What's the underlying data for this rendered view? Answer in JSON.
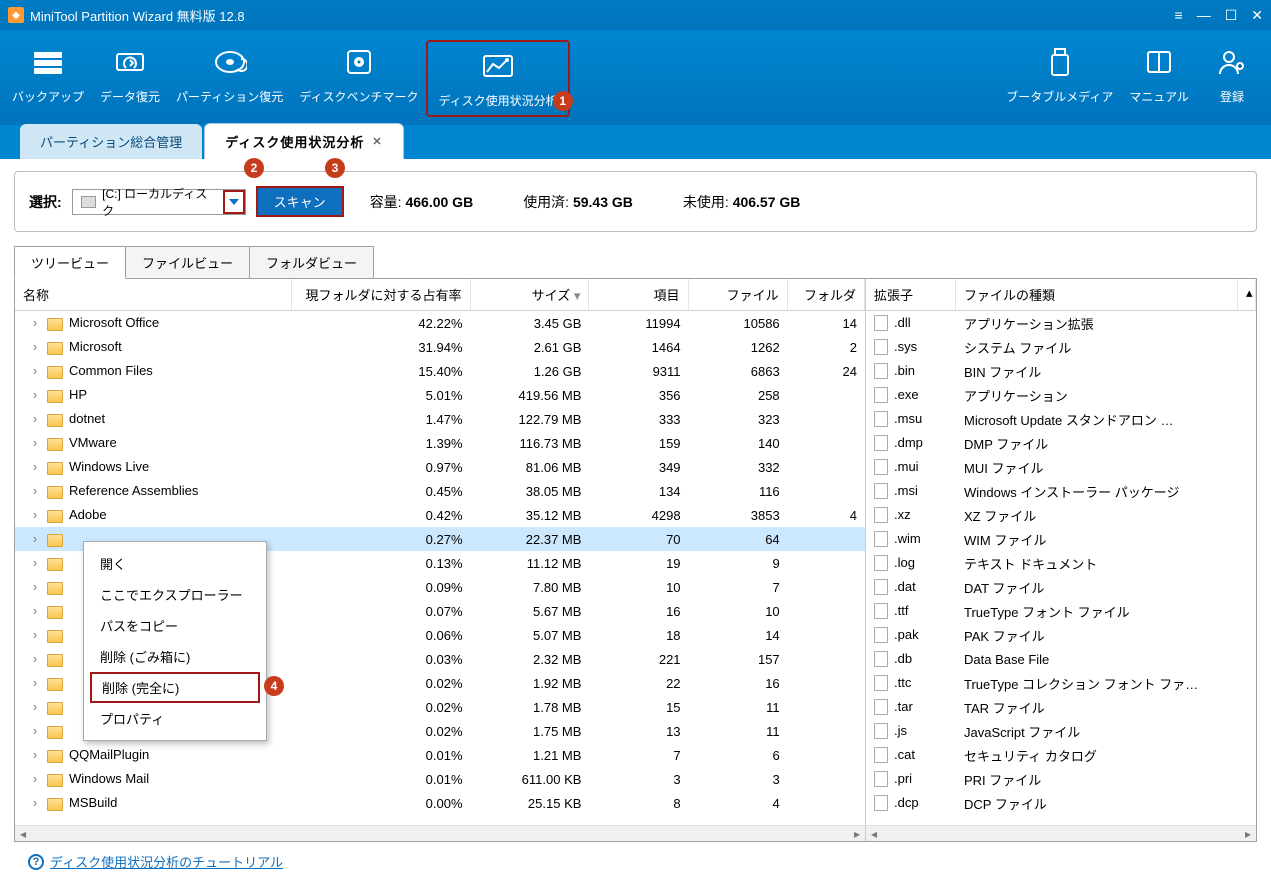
{
  "title": "MiniTool Partition Wizard 無料版 12.8",
  "toolbar": [
    {
      "label": "バックアップ",
      "icon": "backup-icon"
    },
    {
      "label": "データ復元",
      "icon": "data-recovery-icon"
    },
    {
      "label": "パーティション復元",
      "icon": "partition-recovery-icon"
    },
    {
      "label": "ディスクベンチマーク",
      "icon": "benchmark-icon"
    },
    {
      "label": "ディスク使用状況分析",
      "icon": "space-analyzer-icon"
    }
  ],
  "toolbar_right": [
    {
      "label": "ブータブルメディア",
      "icon": "usb-icon"
    },
    {
      "label": "マニュアル",
      "icon": "manual-icon"
    },
    {
      "label": "登録",
      "icon": "register-icon"
    }
  ],
  "app_tabs": {
    "inactive": "パーティション総合管理",
    "active": "ディスク使用状況分析"
  },
  "scan": {
    "select_label": "選択:",
    "selected_disk": "[C:] ローカルディスク",
    "scan_btn": "スキャン",
    "capacity_label": "容量:",
    "capacity_value": "466.00 GB",
    "used_label": "使用済:",
    "used_value": "59.43 GB",
    "free_label": "未使用:",
    "free_value": "406.57 GB"
  },
  "view_tabs": [
    "ツリービュー",
    "ファイルビュー",
    "フォルダビュー"
  ],
  "tree_headers": {
    "name": "名称",
    "pct": "現フォルダに対する占有率",
    "size": "サイズ",
    "items": "項目",
    "files": "ファイル",
    "folders": "フォルダ"
  },
  "tree_rows": [
    {
      "name": "Microsoft Office",
      "pct": "42.22%",
      "size": "3.45 GB",
      "items": "11994",
      "files": "10586",
      "folders": "14"
    },
    {
      "name": "Microsoft",
      "pct": "31.94%",
      "size": "2.61 GB",
      "items": "1464",
      "files": "1262",
      "folders": "2"
    },
    {
      "name": "Common Files",
      "pct": "15.40%",
      "size": "1.26 GB",
      "items": "9311",
      "files": "6863",
      "folders": "24"
    },
    {
      "name": "HP",
      "pct": "5.01%",
      "size": "419.56 MB",
      "items": "356",
      "files": "258",
      "folders": ""
    },
    {
      "name": "dotnet",
      "pct": "1.47%",
      "size": "122.79 MB",
      "items": "333",
      "files": "323",
      "folders": ""
    },
    {
      "name": "VMware",
      "pct": "1.39%",
      "size": "116.73 MB",
      "items": "159",
      "files": "140",
      "folders": ""
    },
    {
      "name": "Windows Live",
      "pct": "0.97%",
      "size": "81.06 MB",
      "items": "349",
      "files": "332",
      "folders": ""
    },
    {
      "name": "Reference Assemblies",
      "pct": "0.45%",
      "size": "38.05 MB",
      "items": "134",
      "files": "116",
      "folders": ""
    },
    {
      "name": "Adobe",
      "pct": "0.42%",
      "size": "35.12 MB",
      "items": "4298",
      "files": "3853",
      "folders": "4"
    },
    {
      "name": "",
      "pct": "0.27%",
      "size": "22.37 MB",
      "items": "70",
      "files": "64",
      "folders": "",
      "sel": true
    },
    {
      "name": "",
      "pct": "0.13%",
      "size": "11.12 MB",
      "items": "19",
      "files": "9",
      "folders": ""
    },
    {
      "name": "",
      "pct": "0.09%",
      "size": "7.80 MB",
      "items": "10",
      "files": "7",
      "folders": ""
    },
    {
      "name": "",
      "pct": "0.07%",
      "size": "5.67 MB",
      "items": "16",
      "files": "10",
      "folders": ""
    },
    {
      "name": "",
      "pct": "0.06%",
      "size": "5.07 MB",
      "items": "18",
      "files": "14",
      "folders": ""
    },
    {
      "name": "",
      "pct": "0.03%",
      "size": "2.32 MB",
      "items": "221",
      "files": "157",
      "folders": ""
    },
    {
      "name": "",
      "pct": "0.02%",
      "size": "1.92 MB",
      "items": "22",
      "files": "16",
      "folders": ""
    },
    {
      "name": "",
      "pct": "0.02%",
      "size": "1.78 MB",
      "items": "15",
      "files": "11",
      "folders": ""
    },
    {
      "name": "",
      "pct": "0.02%",
      "size": "1.75 MB",
      "items": "13",
      "files": "11",
      "folders": ""
    },
    {
      "name": "QQMailPlugin",
      "pct": "0.01%",
      "size": "1.21 MB",
      "items": "7",
      "files": "6",
      "folders": ""
    },
    {
      "name": "Windows Mail",
      "pct": "0.01%",
      "size": "611.00 KB",
      "items": "3",
      "files": "3",
      "folders": ""
    },
    {
      "name": "MSBuild",
      "pct": "0.00%",
      "size": "25.15 KB",
      "items": "8",
      "files": "4",
      "folders": ""
    }
  ],
  "ext_headers": {
    "ext": "拡張子",
    "type": "ファイルの種類"
  },
  "ext_rows": [
    {
      "ext": ".dll",
      "type": "アプリケーション拡張"
    },
    {
      "ext": ".sys",
      "type": "システム ファイル"
    },
    {
      "ext": ".bin",
      "type": "BIN ファイル"
    },
    {
      "ext": ".exe",
      "type": "アプリケーション"
    },
    {
      "ext": ".msu",
      "type": "Microsoft Update スタンドアロン …"
    },
    {
      "ext": ".dmp",
      "type": "DMP ファイル"
    },
    {
      "ext": ".mui",
      "type": "MUI ファイル"
    },
    {
      "ext": ".msi",
      "type": "Windows インストーラー パッケージ"
    },
    {
      "ext": ".xz",
      "type": "XZ ファイル"
    },
    {
      "ext": ".wim",
      "type": "WIM ファイル"
    },
    {
      "ext": ".log",
      "type": "テキスト ドキュメント"
    },
    {
      "ext": ".dat",
      "type": "DAT ファイル"
    },
    {
      "ext": ".ttf",
      "type": "TrueType フォント ファイル"
    },
    {
      "ext": ".pak",
      "type": "PAK ファイル"
    },
    {
      "ext": ".db",
      "type": "Data Base File"
    },
    {
      "ext": ".ttc",
      "type": "TrueType コレクション フォント ファ…"
    },
    {
      "ext": ".tar",
      "type": "TAR ファイル"
    },
    {
      "ext": ".js",
      "type": "JavaScript ファイル"
    },
    {
      "ext": ".cat",
      "type": "セキュリティ カタログ"
    },
    {
      "ext": ".pri",
      "type": "PRI ファイル"
    },
    {
      "ext": ".dcp",
      "type": "DCP ファイル"
    }
  ],
  "context_menu": [
    "開く",
    "ここでエクスプローラー",
    "パスをコピー",
    "削除 (ごみ箱に)",
    "削除 (完全に)",
    "プロパティ"
  ],
  "footer_link": "ディスク使用状況分析のチュートリアル"
}
